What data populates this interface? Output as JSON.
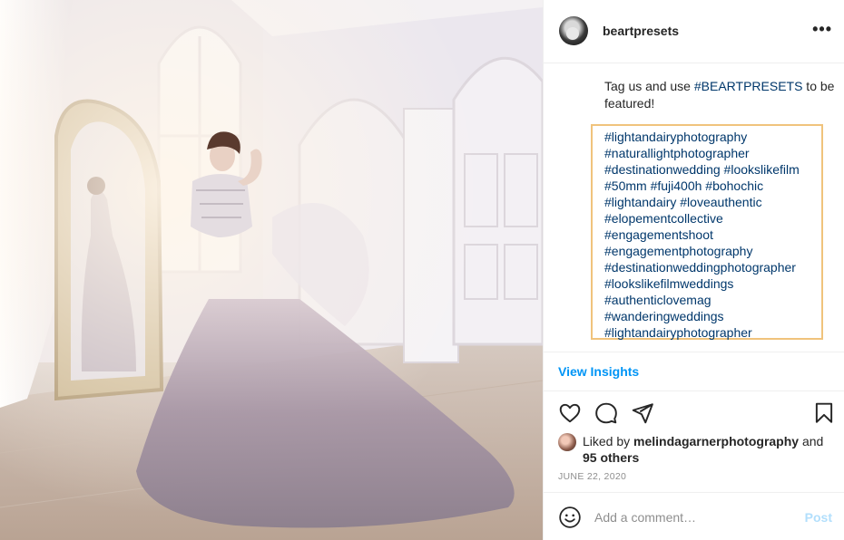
{
  "post": {
    "image_alt": "Bride in a lavender tulle gown posing by a window beside an ornate mirror in a bright white room"
  },
  "header": {
    "username": "beartpresets",
    "more_label": "•••"
  },
  "caption": {
    "text_before": "Tag us and use ",
    "hashtag": "#BEARTPRESETS",
    "text_after": " to be featured!"
  },
  "hashtags": [
    "#lightandairyphotography",
    "#naturallightphotographer",
    "#destinationwedding #lookslikefilm",
    "#50mm #fuji400h #bohochic",
    "#lightandairy #loveauthentic",
    "#elopementcollective",
    "#engagementshoot",
    "#engagementphotography",
    "#destinationweddingphotographer",
    "#lookslikefilmweddings",
    "#authenticlovemag",
    "#wanderingweddings",
    "#lightandairyphotographer"
  ],
  "insights": {
    "label": "View Insights"
  },
  "actions": {
    "like_icon": "heart-icon",
    "comment_icon": "comment-icon",
    "share_icon": "send-icon",
    "save_icon": "bookmark-icon"
  },
  "likes": {
    "prefix": "Liked by ",
    "user": "melindagarnerphotography",
    "joiner": " and",
    "others": "95 others"
  },
  "date": "JUNE 22, 2020",
  "comment": {
    "placeholder": "Add a comment…",
    "post_label": "Post",
    "emoji_icon": "smiley-icon"
  },
  "colors": {
    "link": "#00376b",
    "accent": "#0095f6",
    "post_disabled": "#b2dffc",
    "tag_box_border": "#f0c37c"
  }
}
